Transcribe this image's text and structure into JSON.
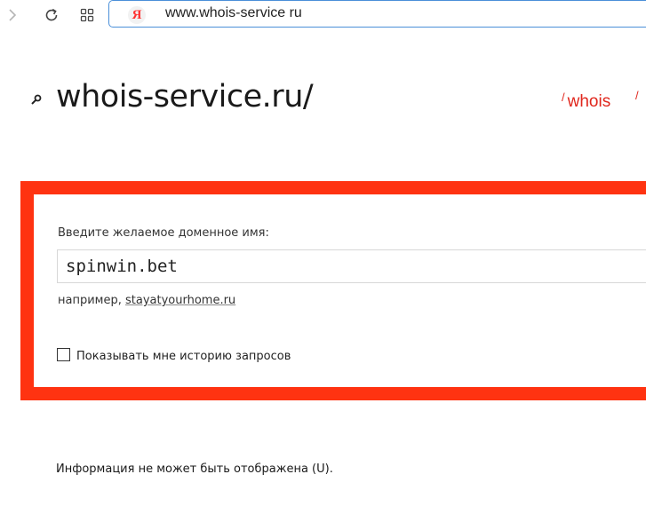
{
  "browser": {
    "address_url": "www.whois-service ru",
    "yandex_logo_letter": "Я",
    "icons": [
      "forward-arrow-icon",
      "reload-icon",
      "tabs-grid-icon",
      "yandex-logo-icon"
    ]
  },
  "header": {
    "site_title": "whois-service.ru/",
    "nav_whois_slash": "/",
    "nav_whois_label": "whois",
    "nav_next_fragment": "/"
  },
  "form": {
    "label": "Введите желаемое доменное имя:",
    "domain_value": "spinwin.bet",
    "example_prefix": "например,",
    "example_link": "stayatyourhome.ru",
    "history_checkbox_checked": false,
    "history_label": "Показывать мне историю запросов"
  },
  "result": {
    "message": "Информация не может быть отображена (U)."
  },
  "colors": {
    "accent_red": "#ff3311",
    "link_red": "#e0261c",
    "address_border": "#4a8fd9"
  }
}
